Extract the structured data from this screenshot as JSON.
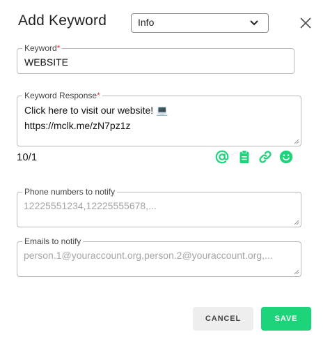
{
  "dialog": {
    "title": "Add Keyword"
  },
  "type_select": {
    "value": "Info"
  },
  "keyword": {
    "label": "Keyword",
    "required_mark": "*",
    "value": "WEBSITE"
  },
  "response": {
    "label": "Keyword Response",
    "required_mark": "*",
    "line1": "Click here to visit our website! 💻",
    "line2": "https://mclk.me/zN7pz1z"
  },
  "counter": "10/1",
  "toolbar_icons": [
    "at-icon",
    "clipboard-icon",
    "link-icon",
    "emoji-icon"
  ],
  "phones": {
    "label": "Phone numbers to notify",
    "placeholder": "12225551234,12225555678,..."
  },
  "emails": {
    "label": "Emails to notify",
    "placeholder": "person.1@youraccount.org,person.2@youraccount.org,..."
  },
  "actions": {
    "cancel": "CANCEL",
    "save": "SAVE"
  },
  "colors": {
    "accent": "#1ed47a",
    "required": "#e53935"
  }
}
